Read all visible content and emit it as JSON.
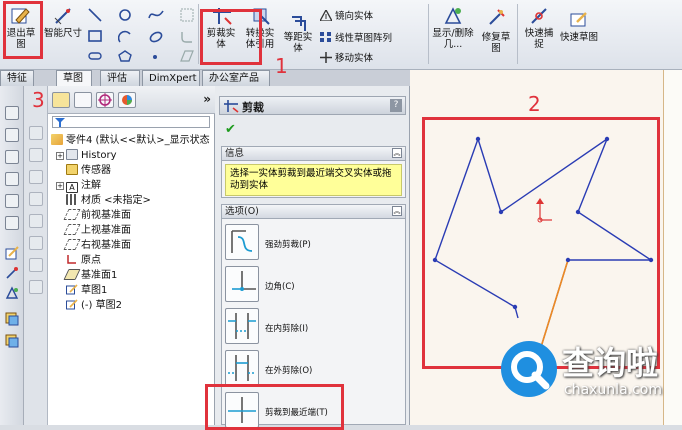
{
  "ribbon": {
    "exit_sketch": "退出草图",
    "smart_dim": "智能尺寸",
    "trim": "剪裁实体",
    "convert": "转换实体引用",
    "offset": "等距实体",
    "mirror": "镜向实体",
    "linear_array": "线性草图阵列",
    "move": "移动实体",
    "display_delete": "显示/删除几...",
    "repair": "修复草图",
    "quick_snap": "快速捕捉",
    "quick_sketch": "快速草图"
  },
  "tabs": [
    "特征",
    "草图",
    "评估",
    "DimXpert",
    "办公室产品"
  ],
  "tree": {
    "root": "零件4 (默认<<默认>_显示状态",
    "items": [
      "History",
      "传感器",
      "注解",
      "材质 <未指定>",
      "前视基准面",
      "上视基准面",
      "右视基准面",
      "原点",
      "基准面1",
      "草图1",
      "(-) 草图2"
    ]
  },
  "pm": {
    "title": "剪裁",
    "help": "?",
    "info_label": "信息",
    "info_text": "选择一实体剪裁到最近端交叉实体或拖动到实体",
    "options_label": "选项(O)",
    "options": [
      "强劲剪裁(P)",
      "边角(C)",
      "在内剪除(I)",
      "在外剪除(O)",
      "剪裁到最近端(T)"
    ]
  },
  "annotations": {
    "n1": "1",
    "n2": "2",
    "n3": "3"
  },
  "watermark": {
    "brand": "查询啦",
    "site": "chaxunla.com"
  },
  "colors": {
    "annotation": "#e0323c",
    "sketch": "#2a3cb4",
    "highlight": "#ee8a22",
    "info_bg": "#ffff99"
  }
}
